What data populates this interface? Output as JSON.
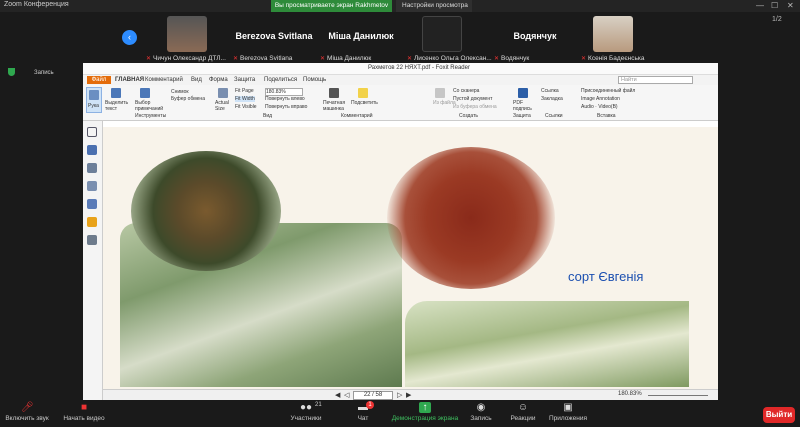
{
  "zoom": {
    "window_title": "Zoom Конференция",
    "share_banner": "Вы просматриваете экран Rakhmetov",
    "view_options": "Настройки просмотра",
    "unmute_label": "Запись",
    "page_indicator": "1/2"
  },
  "participants": [
    {
      "name": "",
      "label": "Чичун Олександр ДТЛ..."
    },
    {
      "name": "Berezova Svitlana",
      "label": "Berezova Svitlana"
    },
    {
      "name": "Міша Данилюк",
      "label": "Міша Данилюк"
    },
    {
      "name": "",
      "label": "Лисенко Ольга Олексан..."
    },
    {
      "name": "Водянчук",
      "label": "Водянчук"
    },
    {
      "name": "",
      "label": "Ксенія Бадеєнська"
    }
  ],
  "reader": {
    "document_title": "Рахметов 22 НЯХТ.pdf - Foxit Reader",
    "file_tab": "Файл",
    "menus": [
      "ГЛАВНАЯ",
      "Комментарий",
      "Вид",
      "Форма",
      "Защита",
      "Поделиться",
      "Помощь"
    ],
    "search_placeholder": "Найти",
    "ribbon": {
      "hand": "Рука",
      "select_text": "Выделить текст",
      "select_annot": "Выбор примечаний",
      "snapshot": "Снимок",
      "clipboard": "Буфер обмена",
      "tools_group": "Инструменты",
      "actual_size": "Actual Size",
      "fit_page": "Fit Page",
      "fit_width": "Fit Width",
      "fit_visible": "Fit Visible",
      "zoom_value": "180.83%",
      "rotate_left": "Повернуть влево",
      "rotate_right": "Повернуть вправо",
      "view_group": "Вид",
      "typewriter": "Печатная машинка",
      "highlight": "Подсветить",
      "comment_group": "Комментарий",
      "from_file": "Из файла",
      "from_scanner": "Со сканера",
      "blank_doc": "Пустой документ",
      "from_clipboard": "Из буфера обмена",
      "create_group": "Создать",
      "sign": "PDF подпись",
      "protect_group": "Защита",
      "link": "Ссылка",
      "bookmark": "Закладка",
      "links_group": "Ссылки",
      "attach_file": "Присоединенный файл",
      "image_annot": "Image Annotation",
      "audio_video": "Audio · Video(B)",
      "insert_group": "Вставка"
    },
    "status": {
      "page": "22 / 58",
      "zoom": "180.83%"
    },
    "slide": {
      "variety": "сорт Євгенія"
    }
  },
  "bottom": {
    "mic": "Включить звук",
    "video": "Начать видео",
    "participants": "Участники",
    "participants_count": "21",
    "chat": "Чат",
    "chat_badge": "1",
    "share": "Демонстрация экрана",
    "record": "Запись",
    "reactions": "Реакции",
    "apps": "Приложения",
    "leave": "Выйти"
  }
}
